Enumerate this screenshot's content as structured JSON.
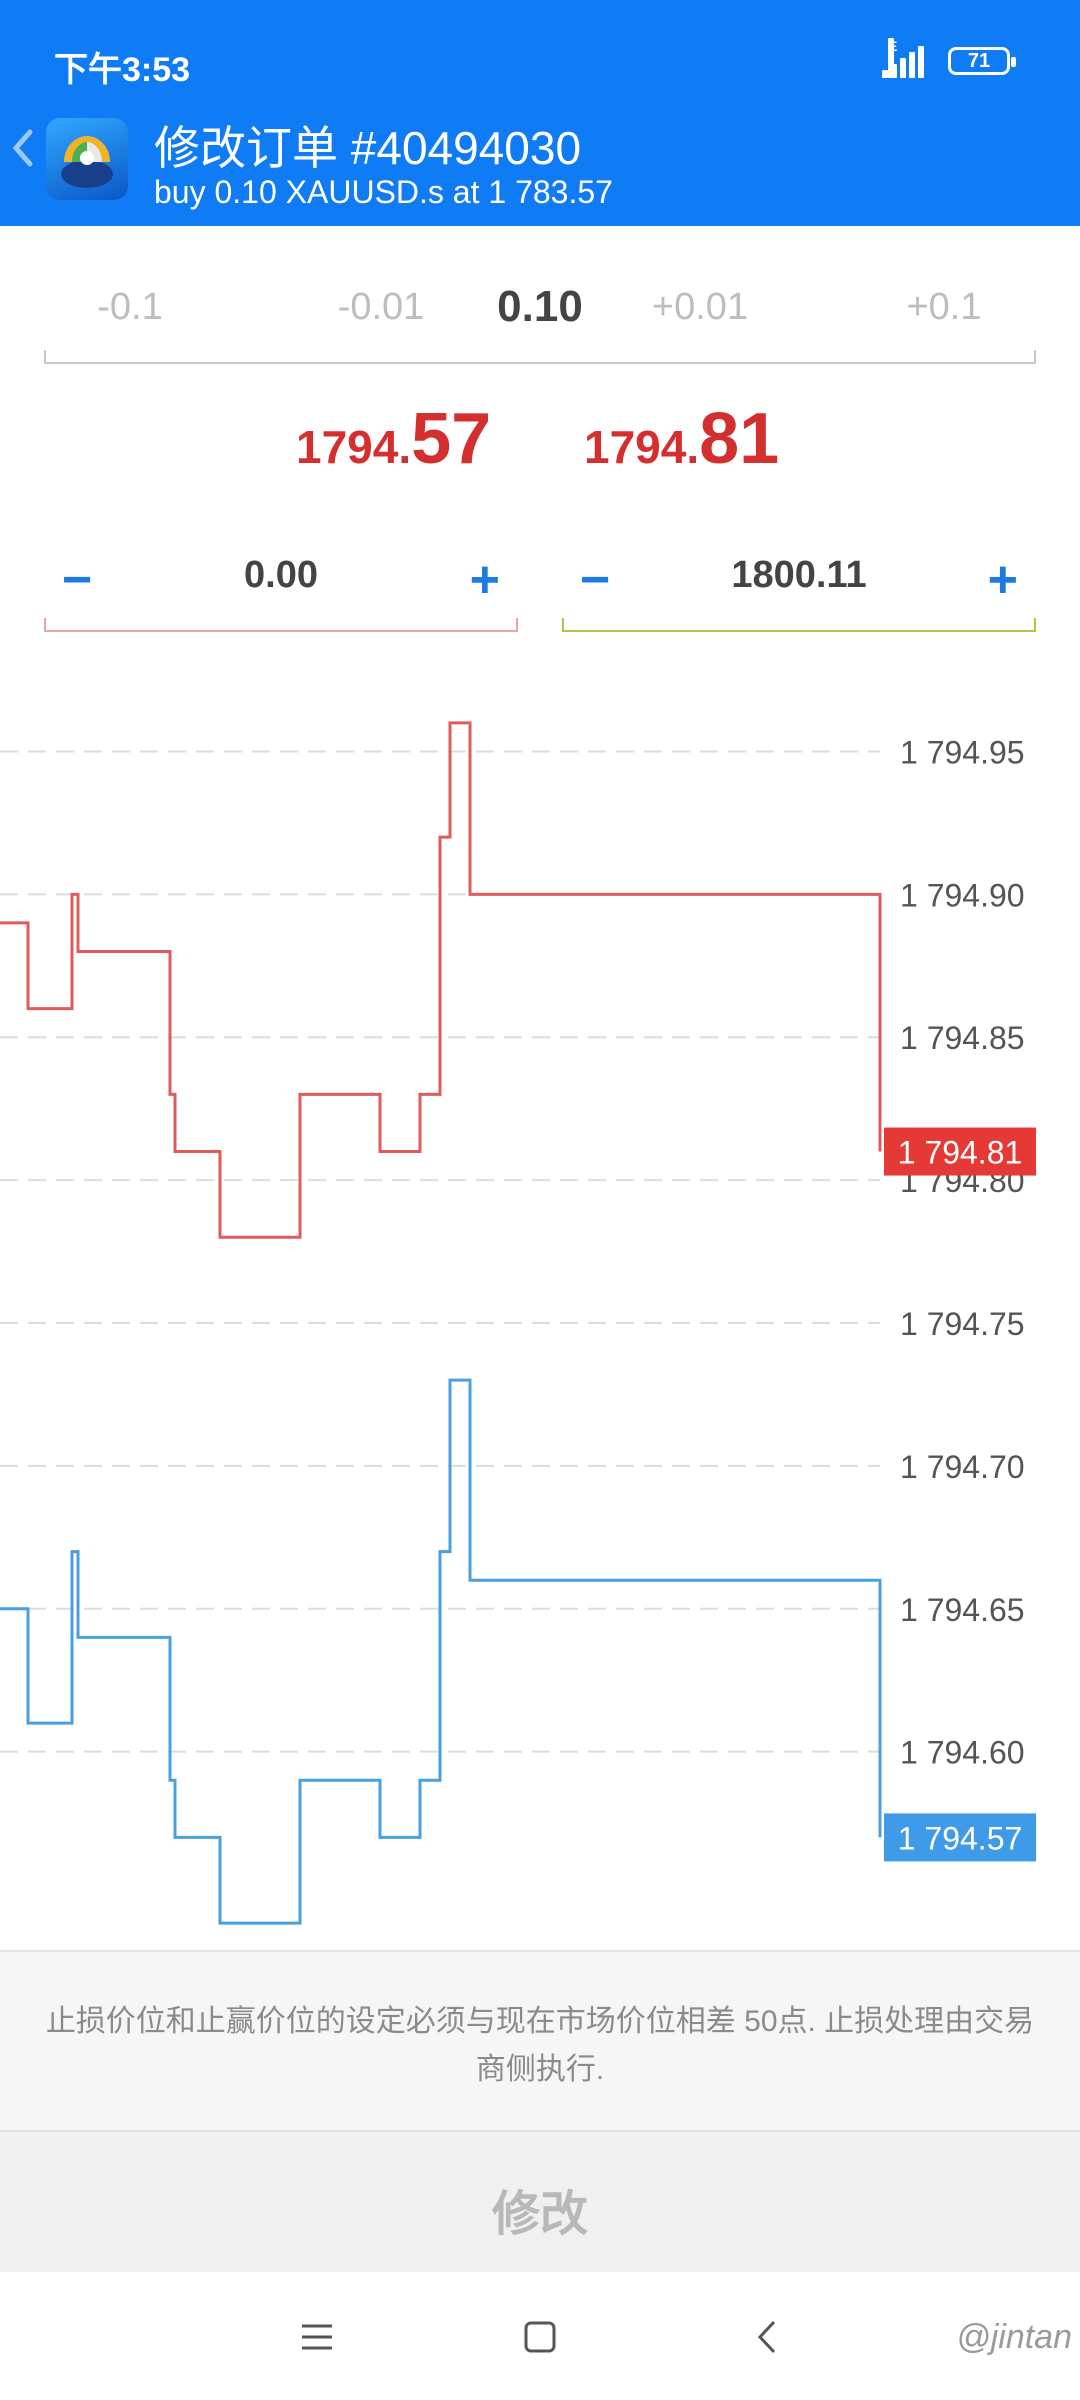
{
  "status_bar": {
    "time": "下午3:53",
    "network": "E",
    "battery": "71"
  },
  "header": {
    "title": "修改订单 #40494030",
    "subtitle": "buy 0.10 XAUUSD.s at 1 783.57"
  },
  "volume_selector": {
    "options": [
      "-0.1",
      "-0.01",
      "0.10",
      "+0.01",
      "+0.1"
    ],
    "selected": "0.10"
  },
  "prices": {
    "bid": {
      "small": "1794.",
      "big": "57"
    },
    "ask": {
      "small": "1794.",
      "big": "81"
    }
  },
  "stop_loss": {
    "minus": "−",
    "value": "0.00",
    "plus": "+"
  },
  "take_profit": {
    "minus": "−",
    "value": "1800.11",
    "plus": "+"
  },
  "colors": {
    "header_blue": "#0f7bf5",
    "ask_line": "#e05b5b",
    "bid_line": "#4a9fdf",
    "sl_underline": "#e8a6a6",
    "tp_underline": "#a8c84a"
  },
  "chart_data": {
    "type": "line",
    "ylim": [
      1794.525,
      1794.975
    ],
    "y_ticks": [
      "1 794.95",
      "1 794.90",
      "1 794.85",
      "1 794.80",
      "1 794.75",
      "1 794.70",
      "1 794.65",
      "1 794.60"
    ],
    "grid": true,
    "series": [
      {
        "values": [
          1794.89,
          1794.89,
          1794.86,
          1794.86,
          1794.9,
          1794.88,
          1794.88,
          1794.83,
          1794.81,
          1794.81,
          1794.78,
          1794.78,
          1794.83,
          1794.83,
          1794.81,
          1794.81,
          1794.83,
          1794.83,
          1794.92,
          1794.92,
          1794.96,
          1794.96,
          1794.9,
          1794.89,
          1794.84,
          1794.84,
          1794.81,
          1794.81,
          1794.81
        ],
        "current_label": "1 794.81",
        "color": "#e05b5b",
        "label_bg": "#e53935"
      },
      {
        "values": [
          1794.65,
          1794.65,
          1794.61,
          1794.61,
          1794.67,
          1794.64,
          1794.64,
          1794.59,
          1794.57,
          1794.57,
          1794.54,
          1794.54,
          1794.59,
          1794.59,
          1794.57,
          1794.57,
          1794.59,
          1794.59,
          1794.67,
          1794.67,
          1794.73,
          1794.73,
          1794.66,
          1794.65,
          1794.6,
          1794.6,
          1794.57,
          1794.57,
          1794.57
        ],
        "current_label": "1 794.57",
        "color": "#4a9fdf",
        "label_bg": "#3f9ae8"
      }
    ]
  },
  "note": "止损价位和止赢价位的设定必须与现在市场价位相差 50点. 止损处理由交易商侧执行.",
  "modify_button": "修改",
  "watermark": "@jintan"
}
